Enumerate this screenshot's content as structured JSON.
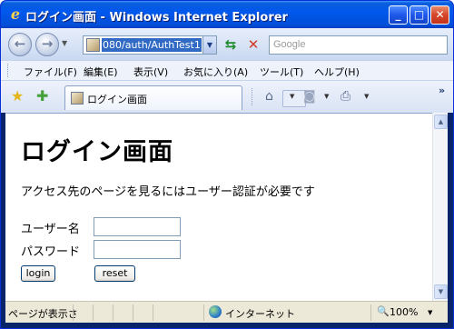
{
  "window": {
    "title": "ログイン画面 - Windows Internet Explorer",
    "minimize_glyph": "_",
    "maximize_glyph": "□",
    "close_glyph": "✕"
  },
  "address_bar": {
    "url_visible": "080/auth/AuthTest1",
    "search_placeholder": "Google"
  },
  "menu": {
    "items": [
      "ファイル(F)",
      "編集(E)",
      "表示(V)",
      "お気に入り(A)",
      "ツール(T)",
      "ヘルプ(H)"
    ]
  },
  "tab": {
    "label": "ログイン画面"
  },
  "icons": {
    "ie": "ie-logo-icon",
    "back": "back-arrow-icon",
    "forward": "forward-arrow-icon",
    "refresh": "refresh-icon",
    "stop": "stop-icon",
    "favorites": "favorites-star-icon",
    "add_favorite": "add-favorite-icon",
    "home": "home-icon",
    "feeds": "feeds-icon",
    "print": "print-icon",
    "internet_zone": "globe-icon",
    "zoom": "zoom-icon"
  },
  "page": {
    "title": "ログイン画面",
    "description": "アクセス先のページを見るにはユーザー認証が必要です",
    "username_label": "ユーザー名",
    "password_label": "パスワード",
    "username_value": "",
    "password_value": "",
    "login_button": "login",
    "reset_button": "reset"
  },
  "status_bar": {
    "status_text": "ページが表示さ",
    "zone": "インターネット",
    "zoom": "100%"
  },
  "colors": {
    "titlebar": "#0054e3",
    "frame": "#0a246a",
    "selection": "#316ac5"
  }
}
